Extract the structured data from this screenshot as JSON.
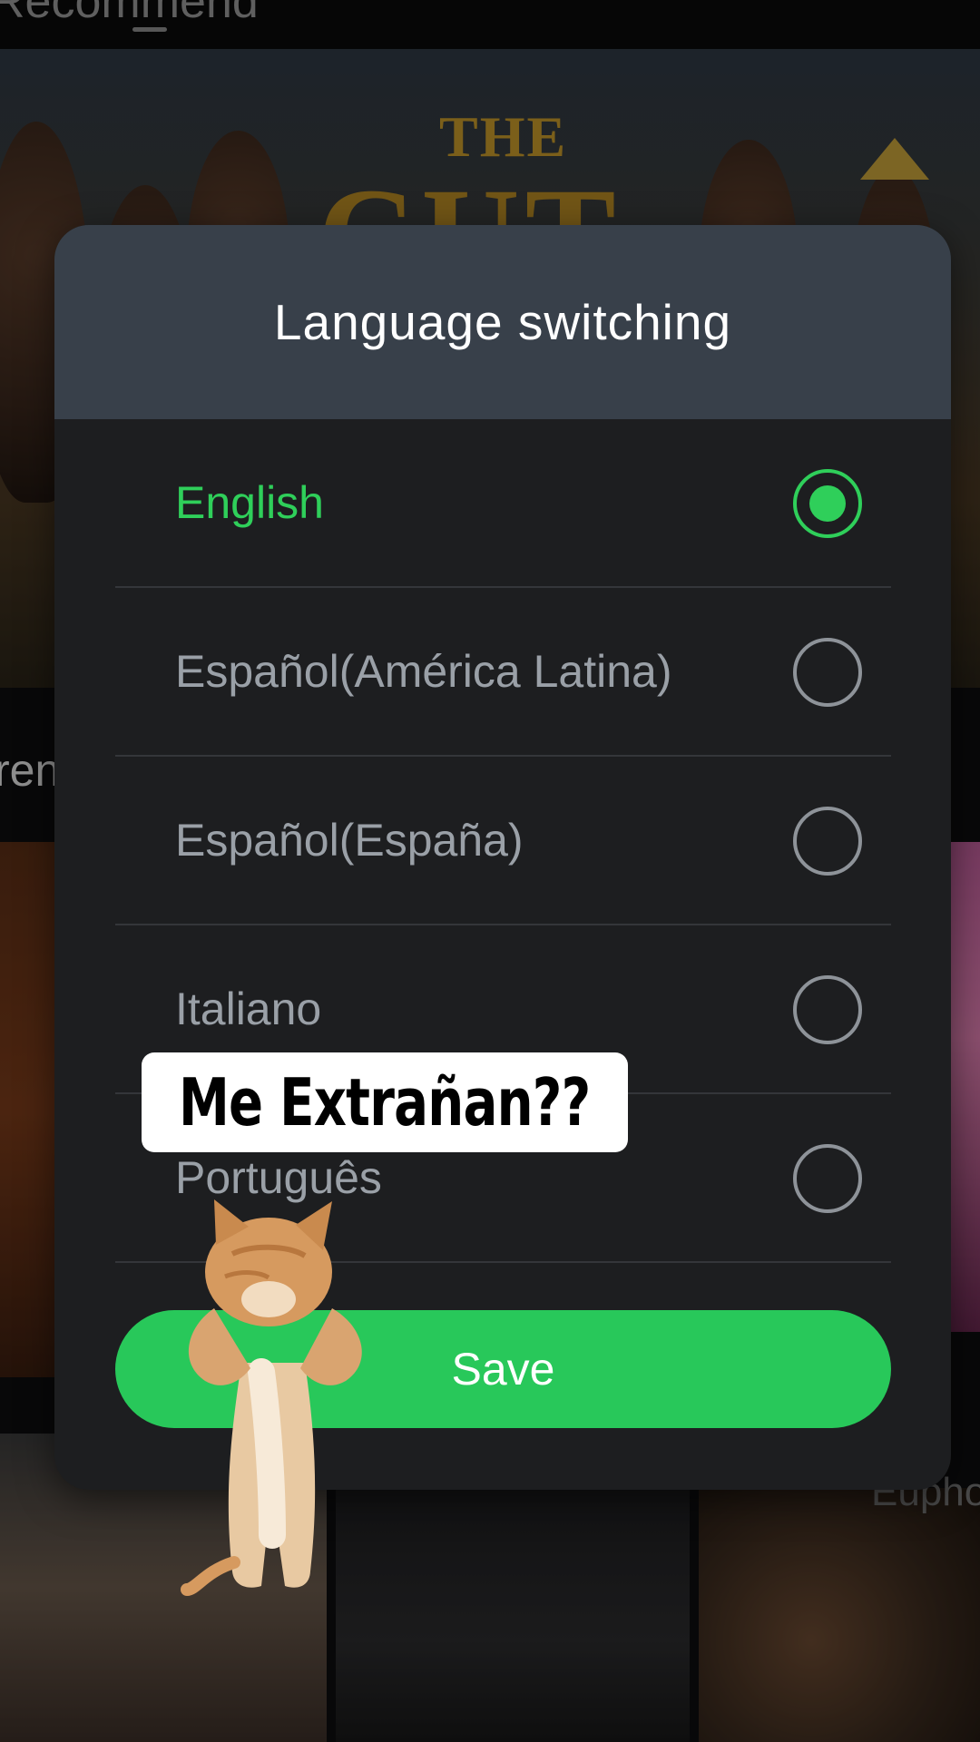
{
  "background": {
    "top_tab_label": "Recommend",
    "hero_title_line1": "THE",
    "hero_title_line2": "CUT",
    "row_label_left": "ren",
    "poster_caption_right": "Euphor"
  },
  "dialog": {
    "title": "Language switching",
    "options": [
      {
        "label": "English",
        "selected": true
      },
      {
        "label": "Español(América Latina)",
        "selected": false
      },
      {
        "label": "Español(España)",
        "selected": false
      },
      {
        "label": "Italiano",
        "selected": false
      },
      {
        "label": "Português",
        "selected": false
      }
    ],
    "save_label": "Save"
  },
  "overlay": {
    "caption": "Me Extrañan??",
    "sticker": "dancing-cat"
  },
  "colors": {
    "accent_green": "#28c85a",
    "header_bg": "#38404a",
    "dialog_bg": "#1d1e20"
  }
}
